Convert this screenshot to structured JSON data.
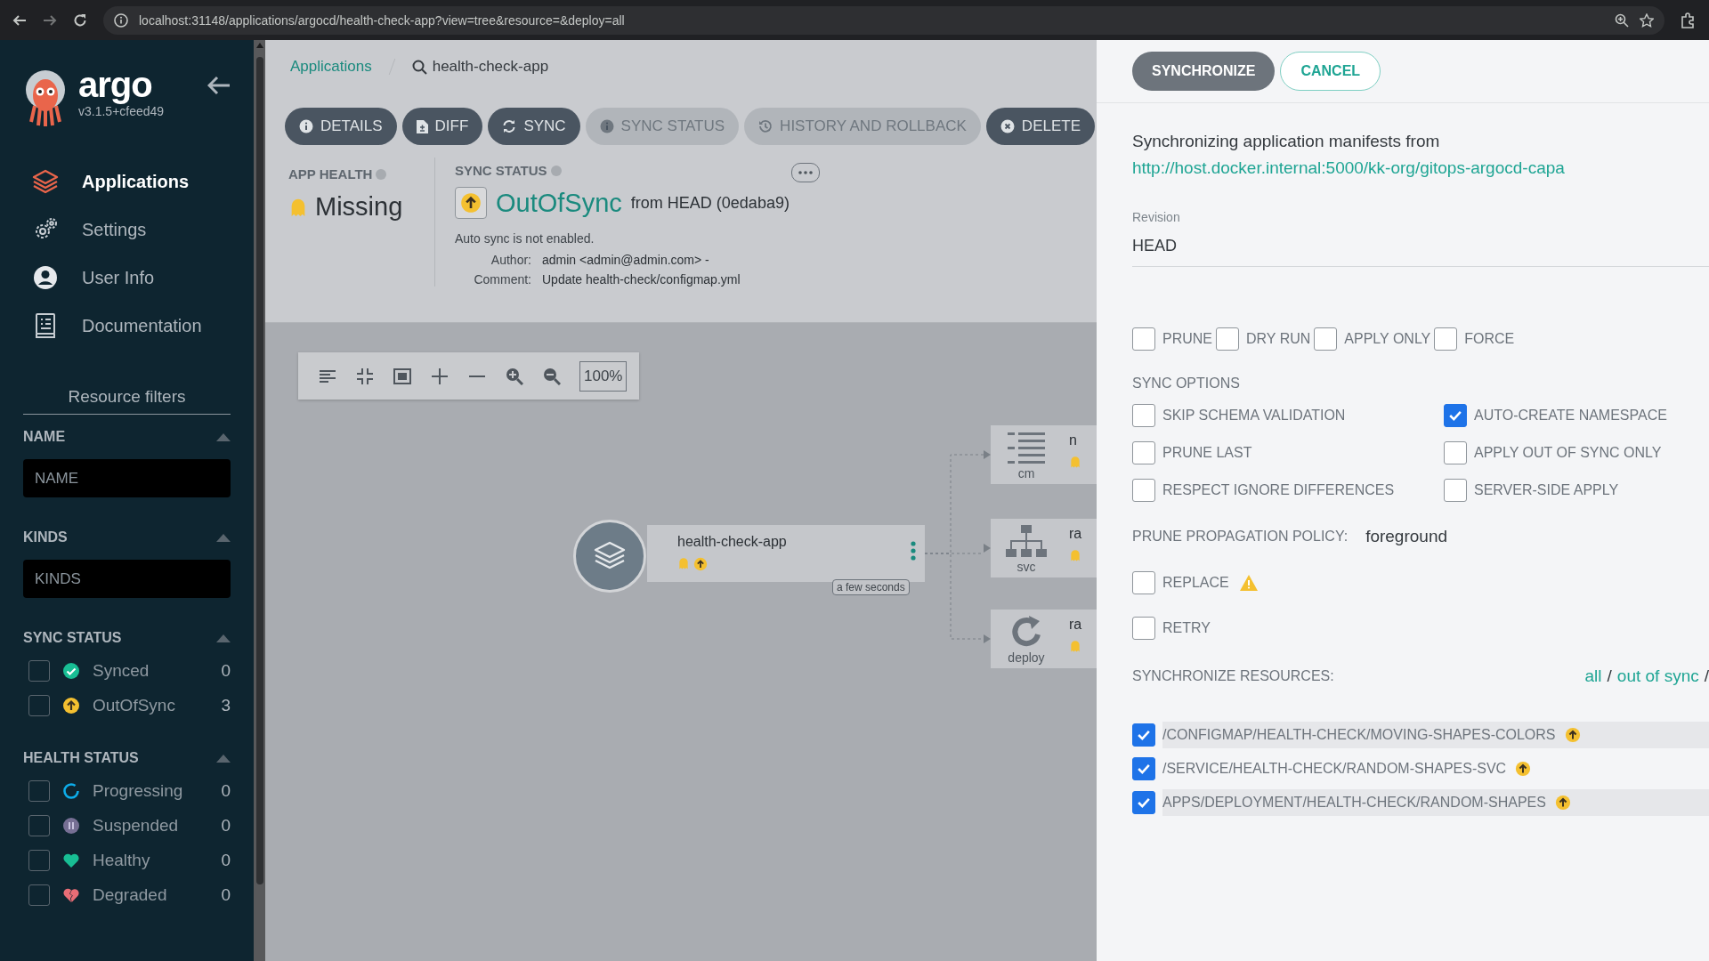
{
  "browser": {
    "url": "localhost:31148/applications/argocd/health-check-app?view=tree&resource=&deploy=all"
  },
  "sidebar": {
    "logo_text": "argo",
    "version": "v3.1.5+cfeed49",
    "nav": [
      {
        "kind": "applications",
        "label": "Applications",
        "selected": true
      },
      {
        "kind": "settings",
        "label": "Settings",
        "selected": false
      },
      {
        "kind": "user",
        "label": "User Info",
        "selected": false
      },
      {
        "kind": "docs",
        "label": "Documentation",
        "selected": false
      }
    ],
    "filters_title": "Resource filters",
    "sections": [
      {
        "kind": "input",
        "title": "NAME",
        "placeholder": "NAME"
      },
      {
        "kind": "input",
        "title": "KINDS",
        "placeholder": "KINDS"
      },
      {
        "kind": "checks",
        "title": "SYNC STATUS",
        "items": [
          {
            "kind": "synced",
            "label": "Synced",
            "count": "0",
            "checked": false
          },
          {
            "kind": "outofsync",
            "label": "OutOfSync",
            "count": "3",
            "checked": false
          }
        ]
      },
      {
        "kind": "checks",
        "title": "HEALTH STATUS",
        "items": [
          {
            "kind": "progressing",
            "label": "Progressing",
            "count": "0",
            "checked": false
          },
          {
            "kind": "suspended",
            "label": "Suspended",
            "count": "0",
            "checked": false
          },
          {
            "kind": "healthy",
            "label": "Healthy",
            "count": "0",
            "checked": false
          },
          {
            "kind": "degraded",
            "label": "Degraded",
            "count": "0",
            "checked": false
          }
        ]
      }
    ]
  },
  "main": {
    "breadcrumb": {
      "link": "Applications",
      "current": "health-check-app"
    },
    "actions": [
      {
        "kind": "info",
        "label": "DETAILS",
        "disabled": false
      },
      {
        "kind": "file",
        "label": "DIFF",
        "disabled": false
      },
      {
        "kind": "sync",
        "label": "SYNC",
        "disabled": false
      },
      {
        "kind": "info",
        "label": "SYNC STATUS",
        "disabled": true
      },
      {
        "kind": "history",
        "label": "HISTORY AND ROLLBACK",
        "disabled": true
      },
      {
        "kind": "delete",
        "label": "DELETE",
        "disabled": false
      }
    ],
    "app_health": {
      "label": "APP HEALTH",
      "status": "Missing"
    },
    "sync_status": {
      "label": "SYNC STATUS",
      "status": "OutOfSync",
      "revision": "from HEAD (0edaba9)",
      "note": "Auto sync is not enabled.",
      "details": [
        {
          "key": "Author:",
          "value": "admin <admin@admin.com> -"
        },
        {
          "key": "Comment:",
          "value": "Update health-check/configmap.yml"
        }
      ]
    },
    "graph": {
      "zoom": "100%",
      "root": {
        "name": "health-check-app",
        "age": "a few seconds"
      },
      "children": [
        {
          "kind": "cm",
          "type": "cm",
          "name": "n"
        },
        {
          "kind": "svc",
          "type": "svc",
          "name": "ra"
        },
        {
          "kind": "deploy",
          "type": "deploy",
          "name": "ra"
        }
      ]
    }
  },
  "panel": {
    "buttons": [
      {
        "kind": "primary",
        "label": "SYNCHRONIZE"
      },
      {
        "kind": "secondary",
        "label": "CANCEL"
      }
    ],
    "intro": "Synchronizing application manifests from",
    "repo_url": "http://host.docker.internal:5000/kk-org/gitops-argocd-capa",
    "revision": {
      "label": "Revision",
      "value": "HEAD"
    },
    "options": [
      {
        "label": "PRUNE",
        "checked": false
      },
      {
        "label": "DRY RUN",
        "checked": false
      },
      {
        "label": "APPLY ONLY",
        "checked": false
      },
      {
        "label": "FORCE",
        "checked": false
      }
    ],
    "sync_options_title": "SYNC OPTIONS",
    "sync_options": [
      {
        "label": "SKIP SCHEMA VALIDATION",
        "checked": false
      },
      {
        "label": "AUTO-CREATE NAMESPACE",
        "checked": true
      },
      {
        "label": "PRUNE LAST",
        "checked": false
      },
      {
        "label": "APPLY OUT OF SYNC ONLY",
        "checked": false
      },
      {
        "label": "RESPECT IGNORE DIFFERENCES",
        "checked": false
      },
      {
        "label": "SERVER-SIDE APPLY",
        "checked": false
      }
    ],
    "prune_policy": {
      "label": "PRUNE PROPAGATION POLICY:",
      "value": "foreground"
    },
    "extra_options": [
      {
        "label": "REPLACE",
        "checked": false,
        "warning": true
      },
      {
        "label": "RETRY",
        "checked": false,
        "warning": false
      }
    ],
    "resources_title": "SYNCHRONIZE RESOURCES:",
    "selectors": [
      {
        "kind": "link",
        "text": "all"
      },
      {
        "kind": "sep",
        "text": "/"
      },
      {
        "kind": "link",
        "text": "out of sync"
      },
      {
        "kind": "sep",
        "text": "/"
      }
    ],
    "resources": [
      {
        "label": "/CONFIGMAP/HEALTH-CHECK/MOVING-SHAPES-COLORS",
        "checked": true
      },
      {
        "label": "/SERVICE/HEALTH-CHECK/RANDOM-SHAPES-SVC",
        "checked": true
      },
      {
        "label": "APPS/DEPLOYMENT/HEALTH-CHECK/RANDOM-SHAPES",
        "checked": true
      }
    ]
  }
}
